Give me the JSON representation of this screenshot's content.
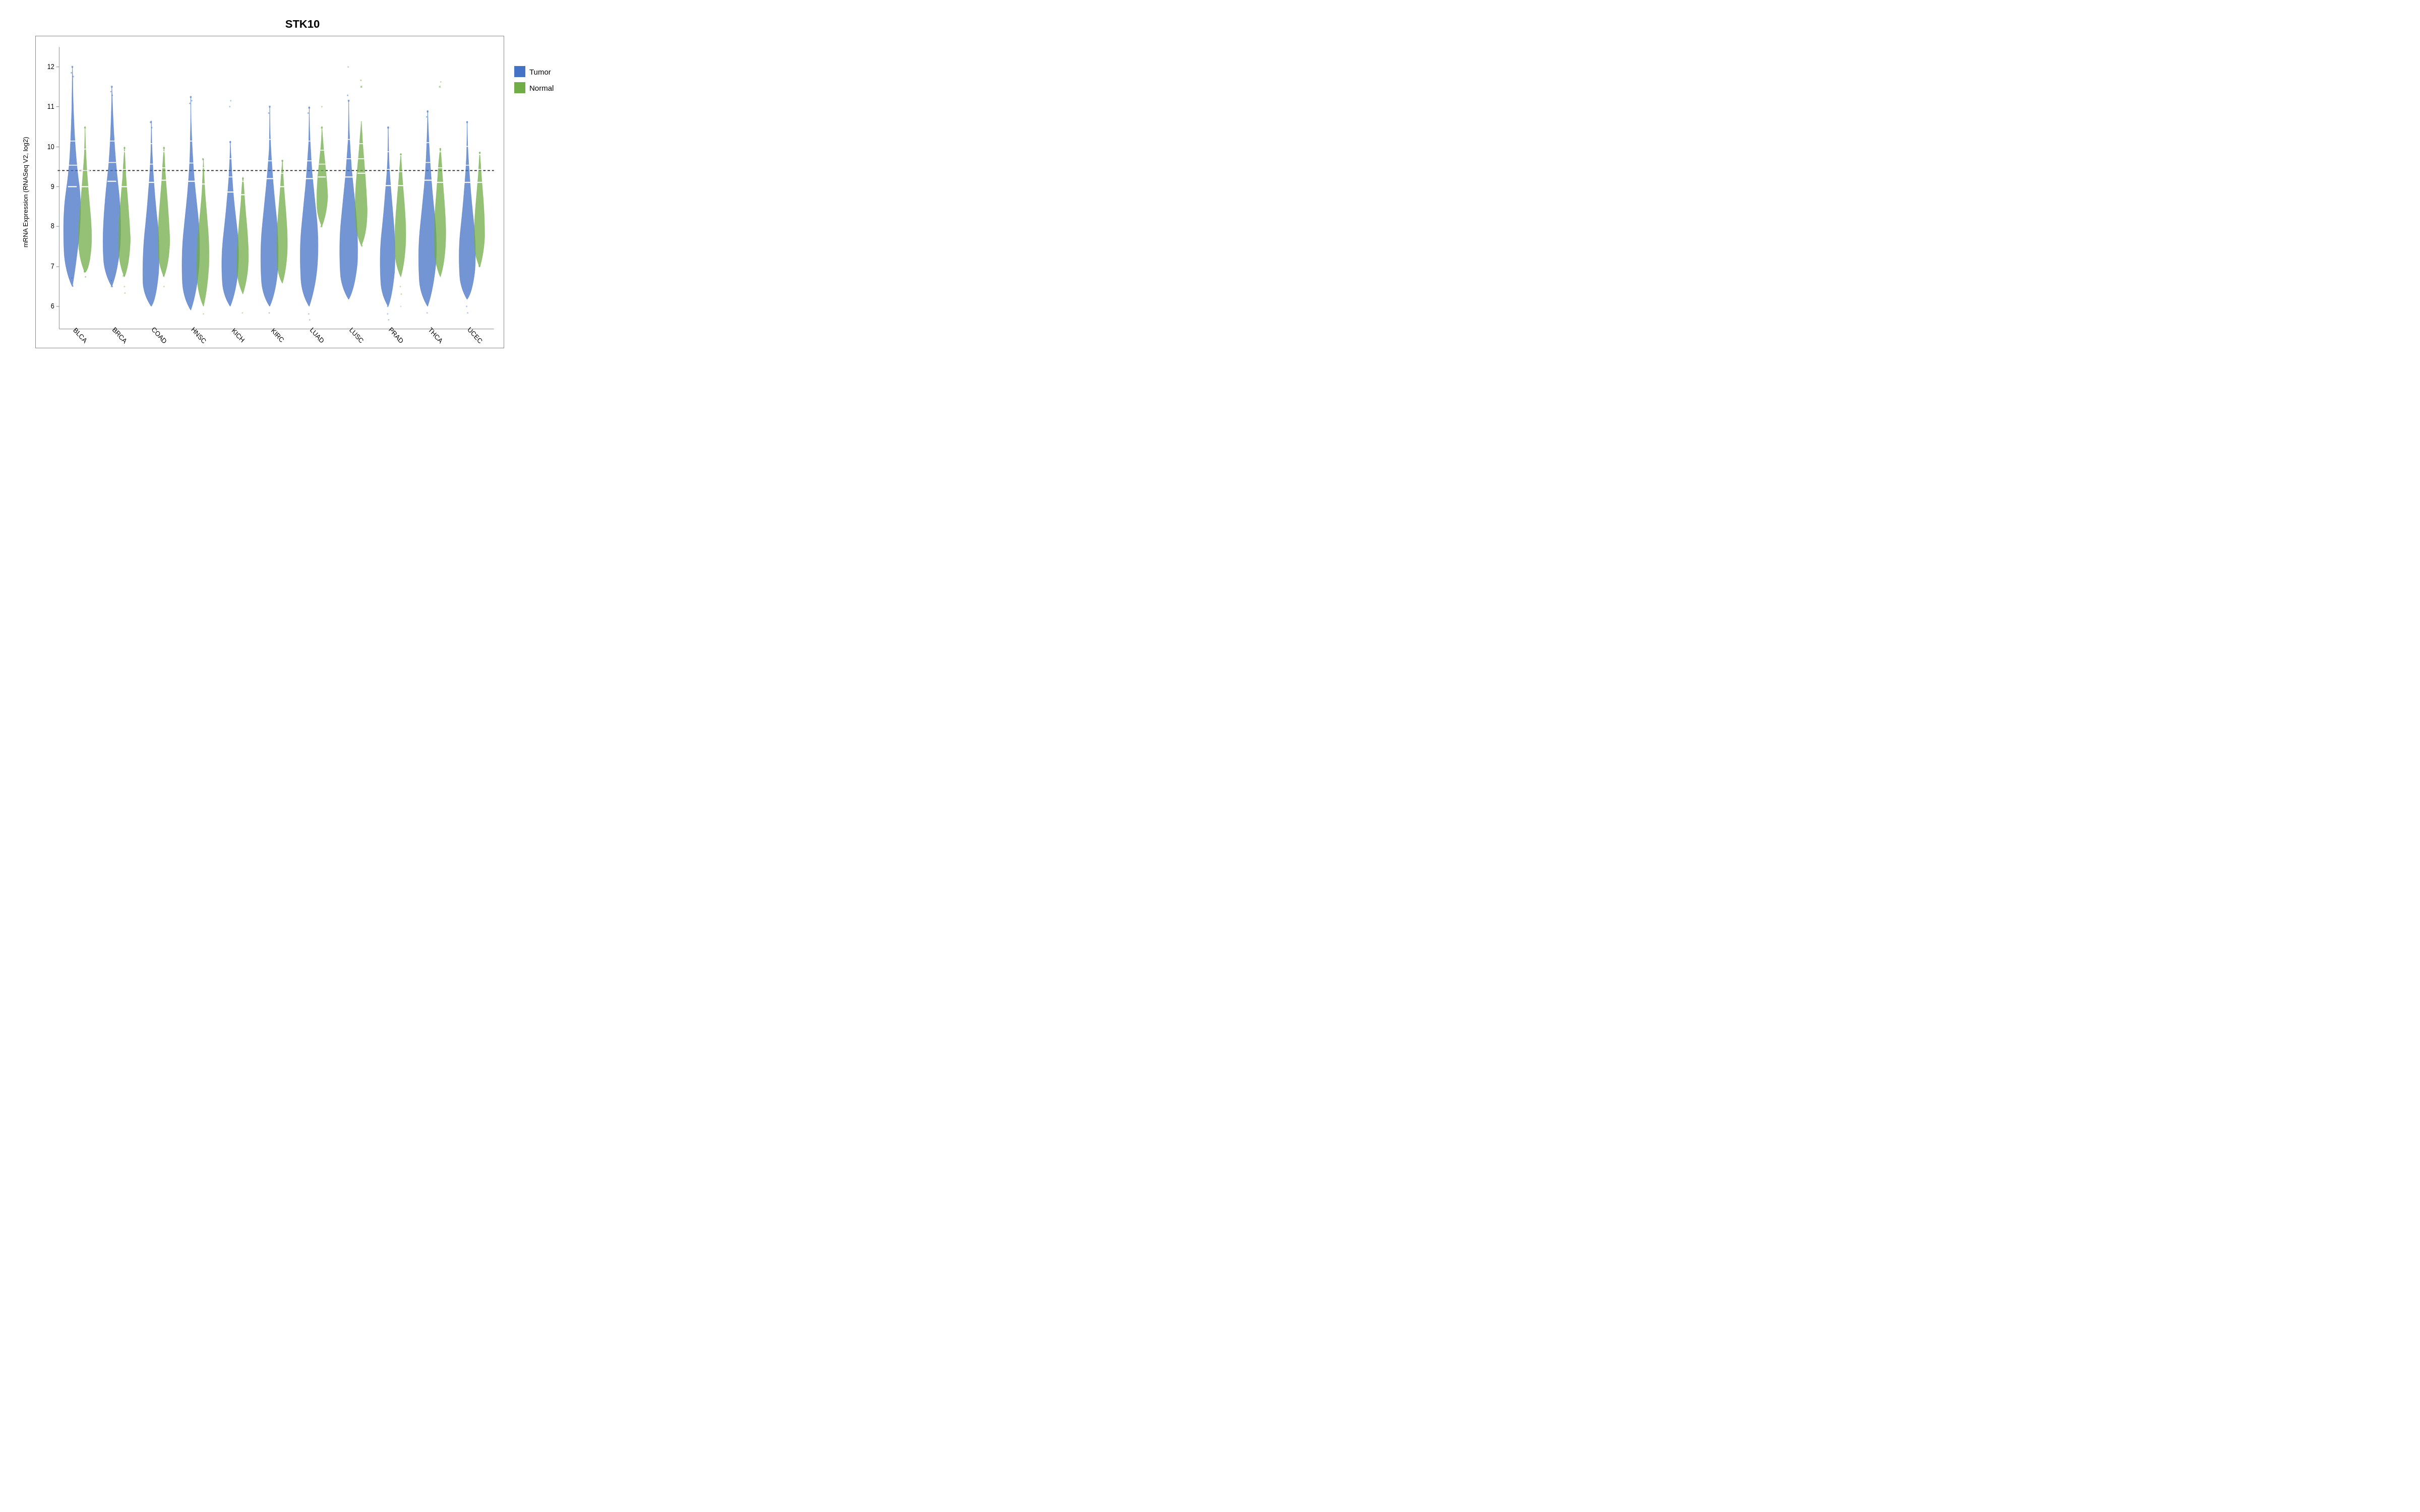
{
  "title": "STK10",
  "yAxisLabel": "mRNA Expression (RNASeq V2, log2)",
  "xLabels": [
    "BLCA",
    "BRCA",
    "COAD",
    "HNSC",
    "KICH",
    "KIRC",
    "LUAD",
    "LUSC",
    "PRAD",
    "THCA",
    "UCEC"
  ],
  "yAxis": {
    "min": 5.5,
    "max": 12.5,
    "ticks": [
      6,
      7,
      8,
      9,
      10,
      11,
      12
    ],
    "refLine": 9.4
  },
  "legend": {
    "items": [
      {
        "label": "Tumor",
        "color": "#4472C4"
      },
      {
        "label": "Normal",
        "color": "#70AD47"
      }
    ]
  },
  "colors": {
    "tumor": "#4472C4",
    "normal": "#70AD47",
    "tumorLight": "#7aa3d9",
    "normalLight": "#a3cc7a"
  }
}
